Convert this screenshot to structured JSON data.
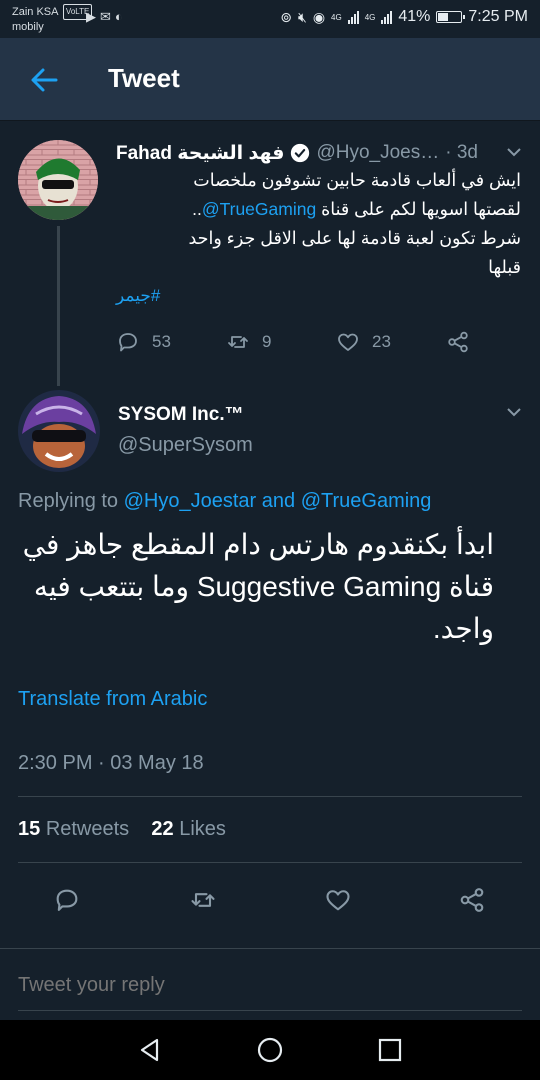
{
  "status_bar": {
    "carrier_line1": "Zain KSA",
    "carrier_volte": "VoLTE",
    "carrier_line2": "mobily",
    "net1": "4G",
    "net2": "4G",
    "battery": "41%",
    "battery_level": 0.41,
    "time": "7:25 PM"
  },
  "app_bar": {
    "title": "Tweet"
  },
  "parent_tweet": {
    "display_name": "Fahad فهد الشيحة",
    "handle": "@Hyo_Joes…",
    "age": "· 3d",
    "body_line1": "ايش في ألعاب قادمة حابين تشوفون ملخصات",
    "body_line2_prefix": "لقصتها اسويها لكم على قناة",
    "body_line2_mention": "@TrueGaming",
    "body_line2_suffix": "..",
    "body_line3": "شرط تكون لعبة قادمة لها على الاقل جزء واحد",
    "body_line4": "قبلها",
    "hashtag": "#جيمر",
    "replies": "53",
    "retweets": "9",
    "likes": "23"
  },
  "focused_tweet": {
    "display_name": "SYSOM Inc.™",
    "handle": "@SuperSysom",
    "replying_prefix": "Replying to",
    "replying_user1": "@Hyo_Joestar",
    "replying_and": "and",
    "replying_user2": "@TrueGaming",
    "text": "ابدأ بكنقدوم هارتس دام المقطع جاهز في قناة Suggestive Gaming وما بتتعب فيه واجد.",
    "translate": "Translate from Arabic",
    "timestamp": "2:30 PM · 03 May 18",
    "retweet_count": "15",
    "retweet_label": "Retweets",
    "like_count": "22",
    "like_label": "Likes"
  },
  "reply_box": {
    "placeholder": "Tweet your reply"
  },
  "colors": {
    "background": "#15202b",
    "header": "#243447",
    "accent": "#1da1f2",
    "muted": "#8899a6",
    "divider": "#38444d"
  },
  "icons": [
    "back-arrow-icon",
    "verified-badge-icon",
    "chevron-down-icon",
    "reply-icon",
    "retweet-icon",
    "like-icon",
    "share-icon",
    "nav-back-icon",
    "nav-home-icon",
    "nav-recents-icon"
  ]
}
